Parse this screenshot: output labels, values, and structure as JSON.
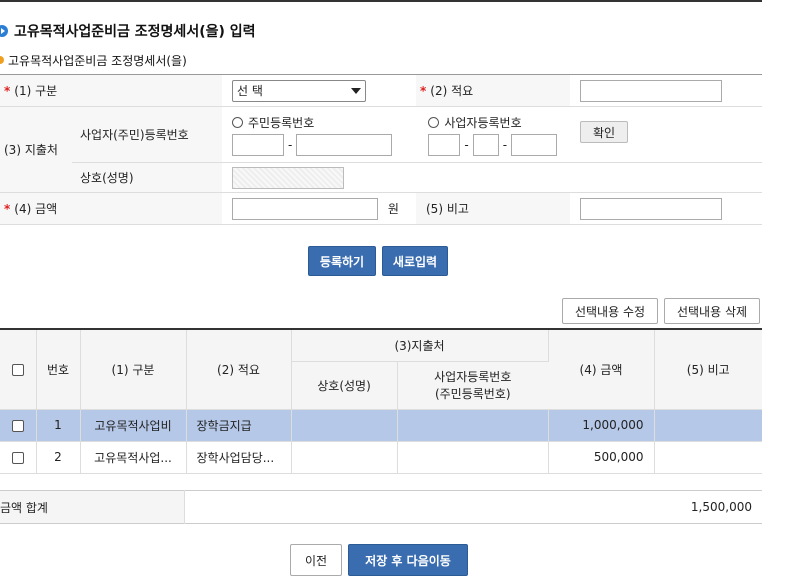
{
  "page": {
    "title": "고유목적사업준비금 조정명세서(을) 입력",
    "subtitle": "고유목적사업준비금 조정명세서(을)"
  },
  "form": {
    "req_mark": "*",
    "gubun_label": "(1) 구분",
    "gubun_value": "선 택",
    "jeokyo_label": "(2) 적요",
    "jichulcheo_label": "(3) 지출처",
    "regno_label": "사업자(주민)등록번호",
    "radio_jumin": "주민등록번호",
    "radio_saeop": "사업자등록번호",
    "dash": "-",
    "confirm_button": "확인",
    "sangho_label": "상호(성명)",
    "amount_label": "(4) 금액",
    "amount_unit": "원",
    "bigo_label": "(5) 비고"
  },
  "actions": {
    "register": "등록하기",
    "new_input": "새로입력",
    "edit_selected": "선택내용 수정",
    "delete_selected": "선택내용 삭제"
  },
  "list": {
    "headers": {
      "num": "번호",
      "gubun": "(1) 구분",
      "jeokyo": "(2) 적요",
      "jichulcheo": "(3)지출처",
      "sangho": "상호(성명)",
      "regno_line1": "사업자등록번호",
      "regno_line2": "(주민등록번호)",
      "amount": "(4) 금액",
      "bigo": "(5) 비고"
    },
    "rows": [
      {
        "num": "1",
        "gubun": "고유목적사업비",
        "jeokyo": "장학금지급",
        "sangho": "",
        "regno": "",
        "amount": "1,000,000",
        "bigo": ""
      },
      {
        "num": "2",
        "gubun": "고유목적사업...",
        "jeokyo": "장학사업담당...",
        "sangho": "",
        "regno": "",
        "amount": "500,000",
        "bigo": ""
      }
    ]
  },
  "summary": {
    "label": "금액 합계",
    "value": "1,500,000"
  },
  "nav": {
    "prev": "이전",
    "save_next": "저장 후 다음이동"
  }
}
